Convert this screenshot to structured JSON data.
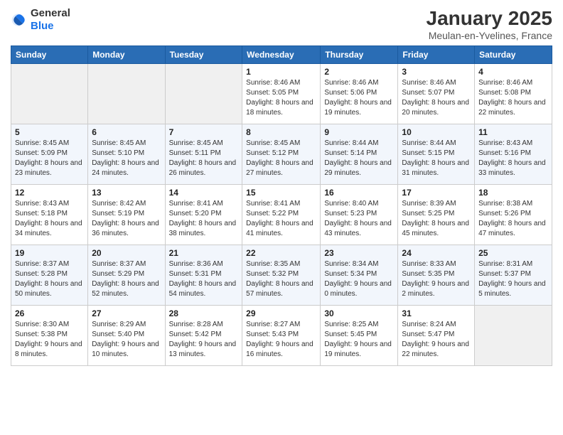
{
  "logo": {
    "text_general": "General",
    "text_blue": "Blue"
  },
  "title": "January 2025",
  "subtitle": "Meulan-en-Yvelines, France",
  "days_of_week": [
    "Sunday",
    "Monday",
    "Tuesday",
    "Wednesday",
    "Thursday",
    "Friday",
    "Saturday"
  ],
  "weeks": [
    [
      {
        "day": "",
        "sunrise": "",
        "sunset": "",
        "daylight": ""
      },
      {
        "day": "",
        "sunrise": "",
        "sunset": "",
        "daylight": ""
      },
      {
        "day": "",
        "sunrise": "",
        "sunset": "",
        "daylight": ""
      },
      {
        "day": "1",
        "sunrise": "Sunrise: 8:46 AM",
        "sunset": "Sunset: 5:05 PM",
        "daylight": "Daylight: 8 hours and 18 minutes."
      },
      {
        "day": "2",
        "sunrise": "Sunrise: 8:46 AM",
        "sunset": "Sunset: 5:06 PM",
        "daylight": "Daylight: 8 hours and 19 minutes."
      },
      {
        "day": "3",
        "sunrise": "Sunrise: 8:46 AM",
        "sunset": "Sunset: 5:07 PM",
        "daylight": "Daylight: 8 hours and 20 minutes."
      },
      {
        "day": "4",
        "sunrise": "Sunrise: 8:46 AM",
        "sunset": "Sunset: 5:08 PM",
        "daylight": "Daylight: 8 hours and 22 minutes."
      }
    ],
    [
      {
        "day": "5",
        "sunrise": "Sunrise: 8:45 AM",
        "sunset": "Sunset: 5:09 PM",
        "daylight": "Daylight: 8 hours and 23 minutes."
      },
      {
        "day": "6",
        "sunrise": "Sunrise: 8:45 AM",
        "sunset": "Sunset: 5:10 PM",
        "daylight": "Daylight: 8 hours and 24 minutes."
      },
      {
        "day": "7",
        "sunrise": "Sunrise: 8:45 AM",
        "sunset": "Sunset: 5:11 PM",
        "daylight": "Daylight: 8 hours and 26 minutes."
      },
      {
        "day": "8",
        "sunrise": "Sunrise: 8:45 AM",
        "sunset": "Sunset: 5:12 PM",
        "daylight": "Daylight: 8 hours and 27 minutes."
      },
      {
        "day": "9",
        "sunrise": "Sunrise: 8:44 AM",
        "sunset": "Sunset: 5:14 PM",
        "daylight": "Daylight: 8 hours and 29 minutes."
      },
      {
        "day": "10",
        "sunrise": "Sunrise: 8:44 AM",
        "sunset": "Sunset: 5:15 PM",
        "daylight": "Daylight: 8 hours and 31 minutes."
      },
      {
        "day": "11",
        "sunrise": "Sunrise: 8:43 AM",
        "sunset": "Sunset: 5:16 PM",
        "daylight": "Daylight: 8 hours and 33 minutes."
      }
    ],
    [
      {
        "day": "12",
        "sunrise": "Sunrise: 8:43 AM",
        "sunset": "Sunset: 5:18 PM",
        "daylight": "Daylight: 8 hours and 34 minutes."
      },
      {
        "day": "13",
        "sunrise": "Sunrise: 8:42 AM",
        "sunset": "Sunset: 5:19 PM",
        "daylight": "Daylight: 8 hours and 36 minutes."
      },
      {
        "day": "14",
        "sunrise": "Sunrise: 8:41 AM",
        "sunset": "Sunset: 5:20 PM",
        "daylight": "Daylight: 8 hours and 38 minutes."
      },
      {
        "day": "15",
        "sunrise": "Sunrise: 8:41 AM",
        "sunset": "Sunset: 5:22 PM",
        "daylight": "Daylight: 8 hours and 41 minutes."
      },
      {
        "day": "16",
        "sunrise": "Sunrise: 8:40 AM",
        "sunset": "Sunset: 5:23 PM",
        "daylight": "Daylight: 8 hours and 43 minutes."
      },
      {
        "day": "17",
        "sunrise": "Sunrise: 8:39 AM",
        "sunset": "Sunset: 5:25 PM",
        "daylight": "Daylight: 8 hours and 45 minutes."
      },
      {
        "day": "18",
        "sunrise": "Sunrise: 8:38 AM",
        "sunset": "Sunset: 5:26 PM",
        "daylight": "Daylight: 8 hours and 47 minutes."
      }
    ],
    [
      {
        "day": "19",
        "sunrise": "Sunrise: 8:37 AM",
        "sunset": "Sunset: 5:28 PM",
        "daylight": "Daylight: 8 hours and 50 minutes."
      },
      {
        "day": "20",
        "sunrise": "Sunrise: 8:37 AM",
        "sunset": "Sunset: 5:29 PM",
        "daylight": "Daylight: 8 hours and 52 minutes."
      },
      {
        "day": "21",
        "sunrise": "Sunrise: 8:36 AM",
        "sunset": "Sunset: 5:31 PM",
        "daylight": "Daylight: 8 hours and 54 minutes."
      },
      {
        "day": "22",
        "sunrise": "Sunrise: 8:35 AM",
        "sunset": "Sunset: 5:32 PM",
        "daylight": "Daylight: 8 hours and 57 minutes."
      },
      {
        "day": "23",
        "sunrise": "Sunrise: 8:34 AM",
        "sunset": "Sunset: 5:34 PM",
        "daylight": "Daylight: 9 hours and 0 minutes."
      },
      {
        "day": "24",
        "sunrise": "Sunrise: 8:33 AM",
        "sunset": "Sunset: 5:35 PM",
        "daylight": "Daylight: 9 hours and 2 minutes."
      },
      {
        "day": "25",
        "sunrise": "Sunrise: 8:31 AM",
        "sunset": "Sunset: 5:37 PM",
        "daylight": "Daylight: 9 hours and 5 minutes."
      }
    ],
    [
      {
        "day": "26",
        "sunrise": "Sunrise: 8:30 AM",
        "sunset": "Sunset: 5:38 PM",
        "daylight": "Daylight: 9 hours and 8 minutes."
      },
      {
        "day": "27",
        "sunrise": "Sunrise: 8:29 AM",
        "sunset": "Sunset: 5:40 PM",
        "daylight": "Daylight: 9 hours and 10 minutes."
      },
      {
        "day": "28",
        "sunrise": "Sunrise: 8:28 AM",
        "sunset": "Sunset: 5:42 PM",
        "daylight": "Daylight: 9 hours and 13 minutes."
      },
      {
        "day": "29",
        "sunrise": "Sunrise: 8:27 AM",
        "sunset": "Sunset: 5:43 PM",
        "daylight": "Daylight: 9 hours and 16 minutes."
      },
      {
        "day": "30",
        "sunrise": "Sunrise: 8:25 AM",
        "sunset": "Sunset: 5:45 PM",
        "daylight": "Daylight: 9 hours and 19 minutes."
      },
      {
        "day": "31",
        "sunrise": "Sunrise: 8:24 AM",
        "sunset": "Sunset: 5:47 PM",
        "daylight": "Daylight: 9 hours and 22 minutes."
      },
      {
        "day": "",
        "sunrise": "",
        "sunset": "",
        "daylight": ""
      }
    ]
  ]
}
